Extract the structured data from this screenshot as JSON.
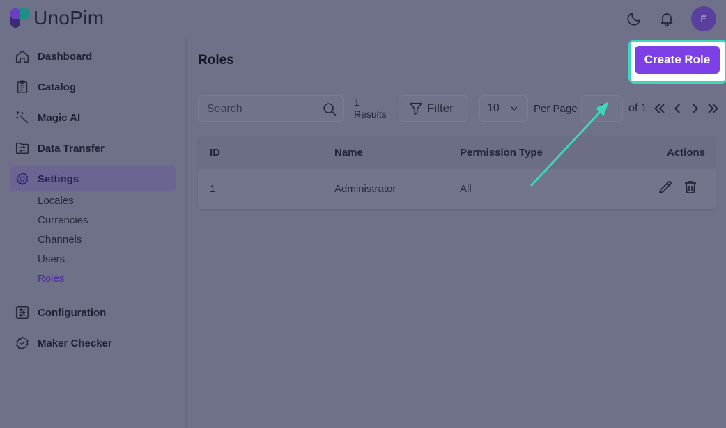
{
  "header": {
    "brand": "UnoPim",
    "avatar_initial": "E",
    "icons": [
      "moon-icon",
      "bell-icon"
    ]
  },
  "sidebar": {
    "items": [
      {
        "label": "Dashboard",
        "icon": "home-icon"
      },
      {
        "label": "Catalog",
        "icon": "clipboard-icon"
      },
      {
        "label": "Magic AI",
        "icon": "magic-wand-icon"
      },
      {
        "label": "Data Transfer",
        "icon": "transfer-icon"
      },
      {
        "label": "Settings",
        "icon": "gear-icon",
        "active": true
      },
      {
        "label": "Configuration",
        "icon": "sliders-icon"
      },
      {
        "label": "Maker Checker",
        "icon": "badge-check-icon"
      }
    ],
    "settings_sub": [
      "Locales",
      "Currencies",
      "Channels",
      "Users",
      "Roles"
    ],
    "active_sub": "Roles"
  },
  "main": {
    "title": "Roles",
    "create_button": "Create Role",
    "search_placeholder": "Search",
    "results_count": "1",
    "results_label": "Results",
    "filter_label": "Filter",
    "per_page_value": "10",
    "per_page_label": "Per Page",
    "page_value": "1",
    "of_label": "of 1"
  },
  "table": {
    "columns": [
      "ID",
      "Name",
      "Permission Type",
      "Actions"
    ],
    "rows": [
      {
        "id": "1",
        "name": "Administrator",
        "permission": "All"
      }
    ]
  },
  "colors": {
    "accent": "#7d3fe6",
    "highlight": "#3fd6bd",
    "annotation_arrow": "#3fd6bd"
  }
}
